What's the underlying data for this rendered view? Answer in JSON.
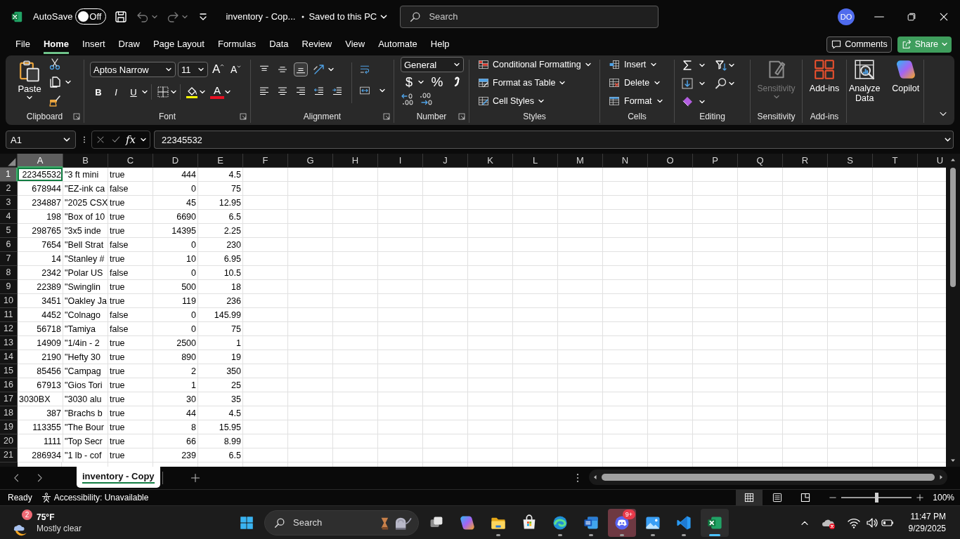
{
  "title_bar": {
    "autosave": {
      "label": "AutoSave",
      "on": false,
      "state_label": "Off"
    },
    "quick_access": [
      {
        "kind": "save",
        "disabled": false
      },
      {
        "kind": "undo",
        "disabled": true
      },
      {
        "kind": "redo",
        "disabled": true
      },
      {
        "kind": "customize",
        "disabled": false
      }
    ],
    "file_name": "inventory - Cop...",
    "save_status": "Saved to this PC",
    "search": {
      "placeholder": "Search"
    },
    "account": {
      "initials": "DO"
    }
  },
  "menu_tabs": [
    {
      "label": "File",
      "selected": false
    },
    {
      "label": "Home",
      "selected": true
    },
    {
      "label": "Insert",
      "selected": false
    },
    {
      "label": "Draw",
      "selected": false
    },
    {
      "label": "Page Layout",
      "selected": false
    },
    {
      "label": "Formulas",
      "selected": false
    },
    {
      "label": "Data",
      "selected": false
    },
    {
      "label": "Review",
      "selected": false
    },
    {
      "label": "View",
      "selected": false
    },
    {
      "label": "Automate",
      "selected": false
    },
    {
      "label": "Help",
      "selected": false
    }
  ],
  "header_buttons": [
    {
      "kind": "comments",
      "label": "Comments"
    },
    {
      "kind": "share",
      "label": "Share"
    }
  ],
  "ribbon": {
    "clipboard": {
      "label": "Clipboard",
      "paste": "Paste"
    },
    "font": {
      "label": "Font",
      "font_name": "Aptos Narrow",
      "font_size": "11",
      "grow": "A",
      "shrink": "A",
      "bold": "B",
      "italic": "I",
      "underline": "U",
      "font_color": "A"
    },
    "alignment": {
      "label": "Alignment",
      "vertical": [
        {
          "kind": "top",
          "selected": false
        },
        {
          "kind": "middle",
          "selected": false
        },
        {
          "kind": "bottom",
          "selected": true
        }
      ],
      "horizontal": [
        {
          "kind": "left",
          "selected": false
        },
        {
          "kind": "center",
          "selected": false
        },
        {
          "kind": "right",
          "selected": false
        }
      ]
    },
    "number": {
      "label": "Number",
      "format": "General",
      "accounting": "$",
      "percent": "%"
    },
    "styles": {
      "label": "Styles",
      "buttons": [
        {
          "kind": "conditional",
          "label": "Conditional Formatting"
        },
        {
          "kind": "table",
          "label": "Format as Table"
        },
        {
          "kind": "cellstyle",
          "label": "Cell Styles"
        }
      ]
    },
    "cells": {
      "label": "Cells",
      "buttons": [
        {
          "kind": "insert",
          "label": "Insert"
        },
        {
          "kind": "delete",
          "label": "Delete"
        },
        {
          "kind": "format",
          "label": "Format"
        }
      ]
    },
    "editing": {
      "label": "Editing"
    },
    "sensitivity": {
      "label": "Sensitivity",
      "button": "Sensitivity",
      "disabled": true
    },
    "addins": {
      "label": "Add-ins",
      "button": "Add-ins"
    },
    "tools": [
      {
        "kind": "analyze",
        "label": "Analyze Data"
      },
      {
        "kind": "copilot",
        "label": "Copilot"
      }
    ]
  },
  "formula_bar": {
    "name_box": "A1",
    "function_symbol": "fx",
    "formula": "22345532"
  },
  "sheet": {
    "columns": [
      {
        "label": "A",
        "selected": true
      },
      {
        "label": "B",
        "selected": false
      },
      {
        "label": "C",
        "selected": false
      },
      {
        "label": "D",
        "selected": false
      },
      {
        "label": "E",
        "selected": false
      },
      {
        "label": "F",
        "selected": false
      },
      {
        "label": "G",
        "selected": false
      },
      {
        "label": "H",
        "selected": false
      },
      {
        "label": "I",
        "selected": false
      },
      {
        "label": "J",
        "selected": false
      },
      {
        "label": "K",
        "selected": false
      },
      {
        "label": "L",
        "selected": false
      },
      {
        "label": "M",
        "selected": false
      },
      {
        "label": "N",
        "selected": false
      },
      {
        "label": "O",
        "selected": false
      },
      {
        "label": "P",
        "selected": false
      },
      {
        "label": "Q",
        "selected": false
      },
      {
        "label": "R",
        "selected": false
      },
      {
        "label": "S",
        "selected": false
      },
      {
        "label": "T",
        "selected": false
      },
      {
        "label": "U",
        "selected": false
      }
    ],
    "rows": [
      {
        "number": "1",
        "selected": true,
        "cells": [
          {
            "text": "22345532",
            "kind": "number"
          },
          {
            "text": "\"3 ft mini",
            "kind": "text"
          },
          {
            "text": "true",
            "kind": "text"
          },
          {
            "text": "444",
            "kind": "number"
          },
          {
            "text": "4.5",
            "kind": "number"
          }
        ]
      },
      {
        "number": "2",
        "selected": false,
        "cells": [
          {
            "text": "678944",
            "kind": "number"
          },
          {
            "text": "\"EZ-ink ca",
            "kind": "text"
          },
          {
            "text": "false",
            "kind": "text"
          },
          {
            "text": "0",
            "kind": "number"
          },
          {
            "text": "75",
            "kind": "number"
          }
        ]
      },
      {
        "number": "3",
        "selected": false,
        "cells": [
          {
            "text": "234887",
            "kind": "number"
          },
          {
            "text": "\"2025 CSX",
            "kind": "text"
          },
          {
            "text": "true",
            "kind": "text"
          },
          {
            "text": "45",
            "kind": "number"
          },
          {
            "text": "12.95",
            "kind": "number"
          }
        ]
      },
      {
        "number": "4",
        "selected": false,
        "cells": [
          {
            "text": "198",
            "kind": "number"
          },
          {
            "text": "\"Box of 10",
            "kind": "text"
          },
          {
            "text": "true",
            "kind": "text"
          },
          {
            "text": "6690",
            "kind": "number"
          },
          {
            "text": "6.5",
            "kind": "number"
          }
        ]
      },
      {
        "number": "5",
        "selected": false,
        "cells": [
          {
            "text": "298765",
            "kind": "number"
          },
          {
            "text": "\"3x5 inde",
            "kind": "text"
          },
          {
            "text": "true",
            "kind": "text"
          },
          {
            "text": "14395",
            "kind": "number"
          },
          {
            "text": "2.25",
            "kind": "number"
          }
        ]
      },
      {
        "number": "6",
        "selected": false,
        "cells": [
          {
            "text": "7654",
            "kind": "number"
          },
          {
            "text": "\"Bell Strat",
            "kind": "text"
          },
          {
            "text": "false",
            "kind": "text"
          },
          {
            "text": "0",
            "kind": "number"
          },
          {
            "text": "230",
            "kind": "number"
          }
        ]
      },
      {
        "number": "7",
        "selected": false,
        "cells": [
          {
            "text": "14",
            "kind": "number"
          },
          {
            "text": "\"Stanley #",
            "kind": "text"
          },
          {
            "text": "true",
            "kind": "text"
          },
          {
            "text": "10",
            "kind": "number"
          },
          {
            "text": "6.95",
            "kind": "number"
          }
        ]
      },
      {
        "number": "8",
        "selected": false,
        "cells": [
          {
            "text": "2342",
            "kind": "number"
          },
          {
            "text": "\"Polar US",
            "kind": "text"
          },
          {
            "text": "false",
            "kind": "text"
          },
          {
            "text": "0",
            "kind": "number"
          },
          {
            "text": "10.5",
            "kind": "number"
          }
        ]
      },
      {
        "number": "9",
        "selected": false,
        "cells": [
          {
            "text": "22389",
            "kind": "number"
          },
          {
            "text": "\"Swinglin",
            "kind": "text"
          },
          {
            "text": "true",
            "kind": "text"
          },
          {
            "text": "500",
            "kind": "number"
          },
          {
            "text": "18",
            "kind": "number"
          }
        ]
      },
      {
        "number": "10",
        "selected": false,
        "cells": [
          {
            "text": "3451",
            "kind": "number"
          },
          {
            "text": "\"Oakley Ja",
            "kind": "text"
          },
          {
            "text": "true",
            "kind": "text"
          },
          {
            "text": "119",
            "kind": "number"
          },
          {
            "text": "236",
            "kind": "number"
          }
        ]
      },
      {
        "number": "11",
        "selected": false,
        "cells": [
          {
            "text": "4452",
            "kind": "number"
          },
          {
            "text": "\"Colnago",
            "kind": "text"
          },
          {
            "text": "false",
            "kind": "text"
          },
          {
            "text": "0",
            "kind": "number"
          },
          {
            "text": "145.99",
            "kind": "number"
          }
        ]
      },
      {
        "number": "12",
        "selected": false,
        "cells": [
          {
            "text": "56718",
            "kind": "number"
          },
          {
            "text": "\"Tamiya",
            "kind": "text"
          },
          {
            "text": "false",
            "kind": "text"
          },
          {
            "text": "0",
            "kind": "number"
          },
          {
            "text": "75",
            "kind": "number"
          }
        ]
      },
      {
        "number": "13",
        "selected": false,
        "cells": [
          {
            "text": "14909",
            "kind": "number"
          },
          {
            "text": "\"1/4in - 2",
            "kind": "text"
          },
          {
            "text": "true",
            "kind": "text"
          },
          {
            "text": "2500",
            "kind": "number"
          },
          {
            "text": "1",
            "kind": "number"
          }
        ]
      },
      {
        "number": "14",
        "selected": false,
        "cells": [
          {
            "text": "2190",
            "kind": "number"
          },
          {
            "text": "\"Hefty 30",
            "kind": "text"
          },
          {
            "text": "true",
            "kind": "text"
          },
          {
            "text": "890",
            "kind": "number"
          },
          {
            "text": "19",
            "kind": "number"
          }
        ]
      },
      {
        "number": "15",
        "selected": false,
        "cells": [
          {
            "text": "85456",
            "kind": "number"
          },
          {
            "text": "\"Campag",
            "kind": "text"
          },
          {
            "text": "true",
            "kind": "text"
          },
          {
            "text": "2",
            "kind": "number"
          },
          {
            "text": "350",
            "kind": "number"
          }
        ]
      },
      {
        "number": "16",
        "selected": false,
        "cells": [
          {
            "text": "67913",
            "kind": "number"
          },
          {
            "text": "\"Gios Tori",
            "kind": "text"
          },
          {
            "text": "true",
            "kind": "text"
          },
          {
            "text": "1",
            "kind": "number"
          },
          {
            "text": "25",
            "kind": "number"
          }
        ]
      },
      {
        "number": "17",
        "selected": false,
        "cells": [
          {
            "text": "3030BX",
            "kind": "text"
          },
          {
            "text": "\"3030 alu",
            "kind": "text"
          },
          {
            "text": "true",
            "kind": "text"
          },
          {
            "text": "30",
            "kind": "number"
          },
          {
            "text": "35",
            "kind": "number"
          }
        ]
      },
      {
        "number": "18",
        "selected": false,
        "cells": [
          {
            "text": "387",
            "kind": "number"
          },
          {
            "text": "\"Brachs b",
            "kind": "text"
          },
          {
            "text": "true",
            "kind": "text"
          },
          {
            "text": "44",
            "kind": "number"
          },
          {
            "text": "4.5",
            "kind": "number"
          }
        ]
      },
      {
        "number": "19",
        "selected": false,
        "cells": [
          {
            "text": "113355",
            "kind": "number"
          },
          {
            "text": "\"The Bour",
            "kind": "text"
          },
          {
            "text": "true",
            "kind": "text"
          },
          {
            "text": "8",
            "kind": "number"
          },
          {
            "text": "15.95",
            "kind": "number"
          }
        ]
      },
      {
        "number": "20",
        "selected": false,
        "cells": [
          {
            "text": "1111",
            "kind": "number"
          },
          {
            "text": "\"Top Secr",
            "kind": "text"
          },
          {
            "text": "true",
            "kind": "text"
          },
          {
            "text": "66",
            "kind": "number"
          },
          {
            "text": "8.99",
            "kind": "number"
          }
        ]
      },
      {
        "number": "21",
        "selected": false,
        "cells": [
          {
            "text": "286934",
            "kind": "number"
          },
          {
            "text": "\"1 lb - cof",
            "kind": "text"
          },
          {
            "text": "true",
            "kind": "text"
          },
          {
            "text": "239",
            "kind": "number"
          },
          {
            "text": "6.5",
            "kind": "number"
          }
        ]
      }
    ]
  },
  "sheet_tabs": [
    {
      "label": "inventory - Copy",
      "selected": true
    }
  ],
  "status_bar": {
    "status": "Ready",
    "accessibility": "Accessibility: Unavailable",
    "views": [
      {
        "kind": "normal",
        "selected": true
      },
      {
        "kind": "page_layout",
        "selected": false
      },
      {
        "kind": "page_break",
        "selected": false
      }
    ],
    "zoom": {
      "level": 0.5,
      "label": "100%"
    }
  },
  "taskbar": {
    "weather": {
      "temperature": "75°F",
      "condition": "Mostly clear",
      "badge": "2"
    },
    "search": {
      "placeholder": "Search"
    },
    "apps": [
      {
        "kind": "taskview",
        "running": false,
        "selected": false,
        "flashing": false
      },
      {
        "kind": "copilot",
        "running": false,
        "selected": false,
        "flashing": false
      },
      {
        "kind": "explorer",
        "running": true,
        "selected": false,
        "flashing": false
      },
      {
        "kind": "store",
        "running": false,
        "selected": false,
        "flashing": false
      },
      {
        "kind": "edge",
        "running": true,
        "selected": false,
        "flashing": false
      },
      {
        "kind": "word",
        "running": true,
        "selected": false,
        "flashing": false
      },
      {
        "kind": "discord",
        "running": true,
        "selected": false,
        "flashing": true,
        "badge": "9+"
      },
      {
        "kind": "photos",
        "running": true,
        "selected": false,
        "flashing": false
      },
      {
        "kind": "code",
        "running": true,
        "selected": false,
        "flashing": false
      },
      {
        "kind": "excel",
        "running": true,
        "selected": true,
        "flashing": false
      }
    ],
    "clock": {
      "time": "11:47 PM",
      "date": "9/29/2025"
    }
  }
}
